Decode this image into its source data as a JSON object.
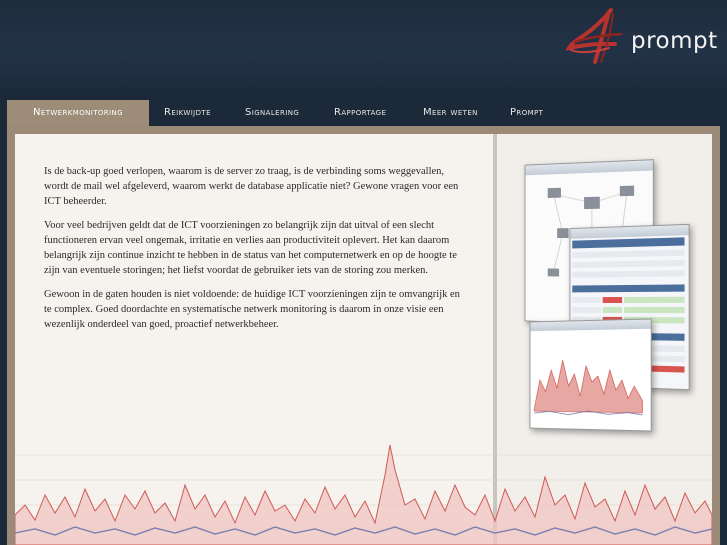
{
  "brand": {
    "name": "prompt",
    "logo_icon": "stylized-4-logo-icon"
  },
  "nav": {
    "items": [
      {
        "label": "Netwerkmonitoring",
        "active": true
      },
      {
        "label": "Reikwijdte",
        "active": false
      },
      {
        "label": "Signalering",
        "active": false
      },
      {
        "label": "Rapportage",
        "active": false
      },
      {
        "label": "Meer weten",
        "active": false
      },
      {
        "label": "Prompt",
        "active": false
      }
    ]
  },
  "content": {
    "paragraphs": [
      "Is de back-up goed verlopen, waarom is de server zo traag, is de verbinding soms weggevallen, wordt de mail wel afgeleverd, waarom werkt de database applicatie niet? Gewone vragen voor een ICT beheerder.",
      "Voor veel bedrijven geldt dat de ICT voorzieningen zo belangrijk zijn dat uitval of een slecht functioneren ervan veel ongemak, irritatie en verlies aan productiviteit oplevert. Het kan daarom belangrijk zijn continue inzicht te hebben in de status van het computernetwerk en op de hoogte te zijn van eventuele storingen; het liefst voordat de gebruiker iets van de storing zou merken.",
      "Gewoon in de gaten houden is niet voldoende: de huidige ICT voorzieningen zijn te omvangrijk en te complex. Goed doordachte en systematische netwerk monitoring is daarom in onze visie een wezenlijk onderdeel van goed, proactief netwerkbeheer."
    ]
  },
  "colors": {
    "header_bg": "#1f2c3d",
    "nav_active": "#9c8c78",
    "frame": "#9a8a77",
    "content_bg": "#f6f3ef",
    "traffic_red": "#d9534f",
    "traffic_blue": "#6f73a8"
  }
}
